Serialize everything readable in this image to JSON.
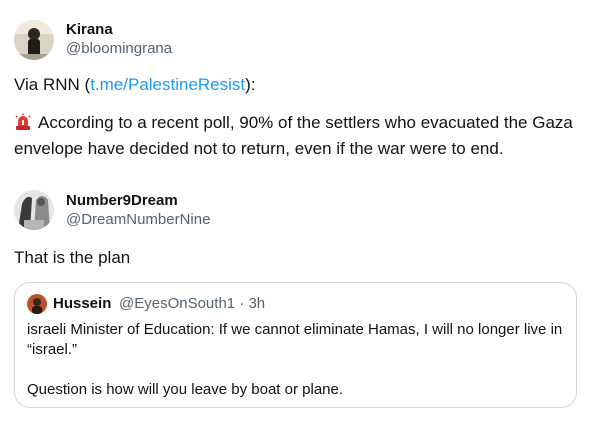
{
  "post1": {
    "name": "Kirana",
    "handle": "@bloomingrana",
    "line1_prefix": "Via RNN (",
    "line1_link": "t.me/PalestineResist",
    "line1_suffix": "):",
    "body": "According to a recent poll, 90% of the settlers who evacuated the Gaza envelope have decided not to return, even if the war were to end.",
    "emoji_icon": "siren-icon"
  },
  "post2": {
    "name": "Number9Dream",
    "handle": "@DreamNumberNine",
    "body": "That is the plan"
  },
  "quote": {
    "name": "Hussein",
    "handle": "@EyesOnSouth1 · 3h",
    "line1": "israeli Minister of Education: If we cannot eliminate Hamas, I will no longer live in “israel.”",
    "line2": "Question is how will you leave by boat or plane."
  },
  "colors": {
    "link": "#1d9bf0",
    "secondary_text": "#536471",
    "border": "#cfd9de"
  }
}
